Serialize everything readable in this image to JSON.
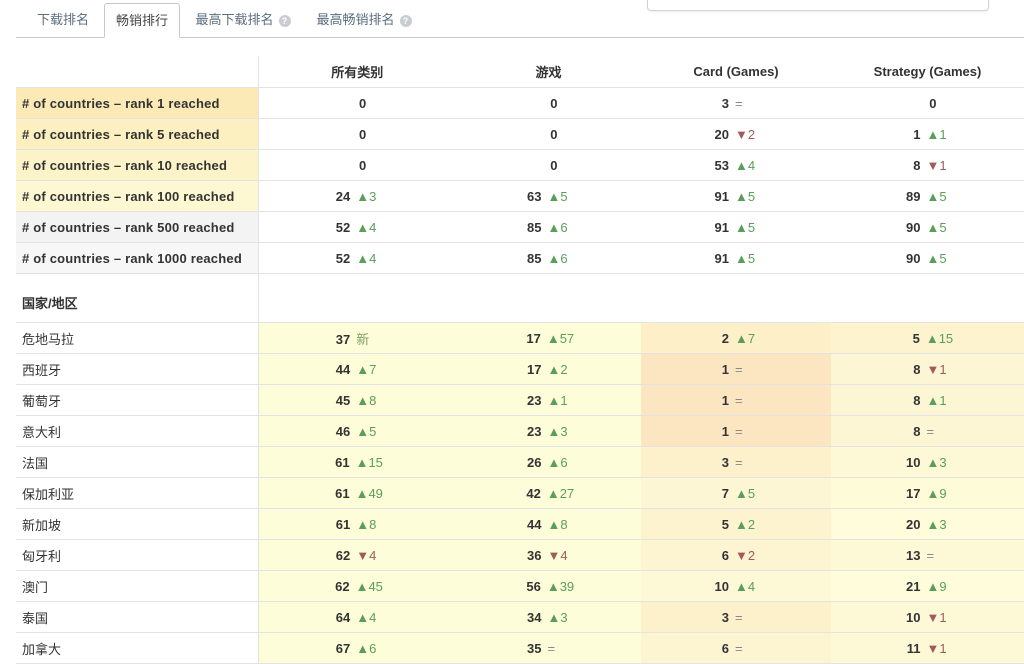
{
  "tabs": [
    {
      "label": "下载排名",
      "active": false,
      "help": false
    },
    {
      "label": "畅销排行",
      "active": true,
      "help": false
    },
    {
      "label": "最高下载排名",
      "active": false,
      "help": true
    },
    {
      "label": "最高畅销排名",
      "active": false,
      "help": true
    }
  ],
  "help_icon": "?",
  "columns": [
    "所有类别",
    "游戏",
    "Card (Games)",
    "Strategy (Games)"
  ],
  "summary_rows": [
    {
      "label": "# of countries – rank 1 reached",
      "bg": "#fbe9b6",
      "cells": [
        {
          "n": "0",
          "dir": "none",
          "d": ""
        },
        {
          "n": "0",
          "dir": "none",
          "d": ""
        },
        {
          "n": "3",
          "dir": "same",
          "d": "="
        },
        {
          "n": "0",
          "dir": "none",
          "d": ""
        }
      ]
    },
    {
      "label": "# of countries – rank 5 reached",
      "bg": "#fcefc0",
      "cells": [
        {
          "n": "0",
          "dir": "none",
          "d": ""
        },
        {
          "n": "0",
          "dir": "none",
          "d": ""
        },
        {
          "n": "20",
          "dir": "down",
          "d": "2"
        },
        {
          "n": "1",
          "dir": "up",
          "d": "1"
        }
      ]
    },
    {
      "label": "# of countries – rank 10 reached",
      "bg": "#fdf3c8",
      "cells": [
        {
          "n": "0",
          "dir": "none",
          "d": ""
        },
        {
          "n": "0",
          "dir": "none",
          "d": ""
        },
        {
          "n": "53",
          "dir": "up",
          "d": "4"
        },
        {
          "n": "8",
          "dir": "down",
          "d": "1"
        }
      ]
    },
    {
      "label": "# of countries – rank 100 reached",
      "bg": "#fef8d2",
      "cells": [
        {
          "n": "24",
          "dir": "up",
          "d": "3"
        },
        {
          "n": "63",
          "dir": "up",
          "d": "5"
        },
        {
          "n": "91",
          "dir": "up",
          "d": "5"
        },
        {
          "n": "89",
          "dir": "up",
          "d": "5"
        }
      ]
    },
    {
      "label": "# of countries – rank 500 reached",
      "bg": "#f3f3f3",
      "cells": [
        {
          "n": "52",
          "dir": "up",
          "d": "4"
        },
        {
          "n": "85",
          "dir": "up",
          "d": "6"
        },
        {
          "n": "91",
          "dir": "up",
          "d": "5"
        },
        {
          "n": "90",
          "dir": "up",
          "d": "5"
        }
      ]
    },
    {
      "label": "# of countries – rank 1000 reached",
      "bg": "#f7f7f7",
      "cells": [
        {
          "n": "52",
          "dir": "up",
          "d": "4"
        },
        {
          "n": "85",
          "dir": "up",
          "d": "6"
        },
        {
          "n": "91",
          "dir": "up",
          "d": "5"
        },
        {
          "n": "90",
          "dir": "up",
          "d": "5"
        }
      ]
    }
  ],
  "section_label": "国家/地区",
  "country_rows": [
    {
      "label": "危地马拉",
      "cells": [
        {
          "n": "37",
          "dir": "new",
          "d": "新",
          "bg": "#fefdd9"
        },
        {
          "n": "17",
          "dir": "up",
          "d": "57",
          "bg": "#fefdd9"
        },
        {
          "n": "2",
          "dir": "up",
          "d": "7",
          "bg": "#fdefc7"
        },
        {
          "n": "5",
          "dir": "up",
          "d": "15",
          "bg": "#fdf4cf"
        }
      ]
    },
    {
      "label": "西班牙",
      "cells": [
        {
          "n": "44",
          "dir": "up",
          "d": "7",
          "bg": "#fefdd9"
        },
        {
          "n": "17",
          "dir": "up",
          "d": "2",
          "bg": "#fefdd9"
        },
        {
          "n": "1",
          "dir": "same",
          "d": "=",
          "bg": "#fbe6c1"
        },
        {
          "n": "8",
          "dir": "down",
          "d": "1",
          "bg": "#fdf6d4"
        }
      ]
    },
    {
      "label": "葡萄牙",
      "cells": [
        {
          "n": "45",
          "dir": "up",
          "d": "8",
          "bg": "#fefdd9"
        },
        {
          "n": "23",
          "dir": "up",
          "d": "1",
          "bg": "#fefdd9"
        },
        {
          "n": "1",
          "dir": "same",
          "d": "=",
          "bg": "#fbe6c1"
        },
        {
          "n": "8",
          "dir": "up",
          "d": "1",
          "bg": "#fdf6d4"
        }
      ]
    },
    {
      "label": "意大利",
      "cells": [
        {
          "n": "46",
          "dir": "up",
          "d": "5",
          "bg": "#fefdd9"
        },
        {
          "n": "23",
          "dir": "up",
          "d": "3",
          "bg": "#fefdd9"
        },
        {
          "n": "1",
          "dir": "same",
          "d": "=",
          "bg": "#fbe6c1"
        },
        {
          "n": "8",
          "dir": "same",
          "d": "=",
          "bg": "#fdf6d4"
        }
      ]
    },
    {
      "label": "法国",
      "cells": [
        {
          "n": "61",
          "dir": "up",
          "d": "15",
          "bg": "#fefdd9"
        },
        {
          "n": "26",
          "dir": "up",
          "d": "6",
          "bg": "#fefdd9"
        },
        {
          "n": "3",
          "dir": "same",
          "d": "=",
          "bg": "#fdf1cc"
        },
        {
          "n": "10",
          "dir": "up",
          "d": "3",
          "bg": "#fdf8d6"
        }
      ]
    },
    {
      "label": "保加利亚",
      "cells": [
        {
          "n": "61",
          "dir": "up",
          "d": "49",
          "bg": "#fefdd9"
        },
        {
          "n": "42",
          "dir": "up",
          "d": "27",
          "bg": "#fefdd9"
        },
        {
          "n": "7",
          "dir": "up",
          "d": "5",
          "bg": "#fdf6d4"
        },
        {
          "n": "17",
          "dir": "up",
          "d": "9",
          "bg": "#fefbd9"
        }
      ]
    },
    {
      "label": "新加坡",
      "cells": [
        {
          "n": "61",
          "dir": "up",
          "d": "8",
          "bg": "#fefdd9"
        },
        {
          "n": "44",
          "dir": "up",
          "d": "8",
          "bg": "#fefdd9"
        },
        {
          "n": "5",
          "dir": "up",
          "d": "2",
          "bg": "#fdf4cf"
        },
        {
          "n": "20",
          "dir": "up",
          "d": "3",
          "bg": "#fefcda"
        }
      ]
    },
    {
      "label": "匈牙利",
      "cells": [
        {
          "n": "62",
          "dir": "down",
          "d": "4",
          "bg": "#fefdd9"
        },
        {
          "n": "36",
          "dir": "down",
          "d": "4",
          "bg": "#fefdd9"
        },
        {
          "n": "6",
          "dir": "down",
          "d": "2",
          "bg": "#fdf5d2"
        },
        {
          "n": "13",
          "dir": "same",
          "d": "=",
          "bg": "#fdf9d7"
        }
      ]
    },
    {
      "label": "澳门",
      "cells": [
        {
          "n": "62",
          "dir": "up",
          "d": "45",
          "bg": "#fefdd9"
        },
        {
          "n": "56",
          "dir": "up",
          "d": "39",
          "bg": "#fefdd9"
        },
        {
          "n": "10",
          "dir": "up",
          "d": "4",
          "bg": "#fdf8d6"
        },
        {
          "n": "21",
          "dir": "up",
          "d": "9",
          "bg": "#fefcda"
        }
      ]
    },
    {
      "label": "泰国",
      "cells": [
        {
          "n": "64",
          "dir": "up",
          "d": "4",
          "bg": "#fefdd9"
        },
        {
          "n": "34",
          "dir": "up",
          "d": "3",
          "bg": "#fefdd9"
        },
        {
          "n": "3",
          "dir": "same",
          "d": "=",
          "bg": "#fdf1cc"
        },
        {
          "n": "10",
          "dir": "down",
          "d": "1",
          "bg": "#fdf8d6"
        }
      ]
    },
    {
      "label": "加拿大",
      "cells": [
        {
          "n": "67",
          "dir": "up",
          "d": "6",
          "bg": "#fefdd9"
        },
        {
          "n": "35",
          "dir": "same",
          "d": "=",
          "bg": "#fefdd9"
        },
        {
          "n": "6",
          "dir": "same",
          "d": "=",
          "bg": "#fdf5d2"
        },
        {
          "n": "11",
          "dir": "down",
          "d": "1",
          "bg": "#fdf8d6"
        }
      ]
    }
  ]
}
